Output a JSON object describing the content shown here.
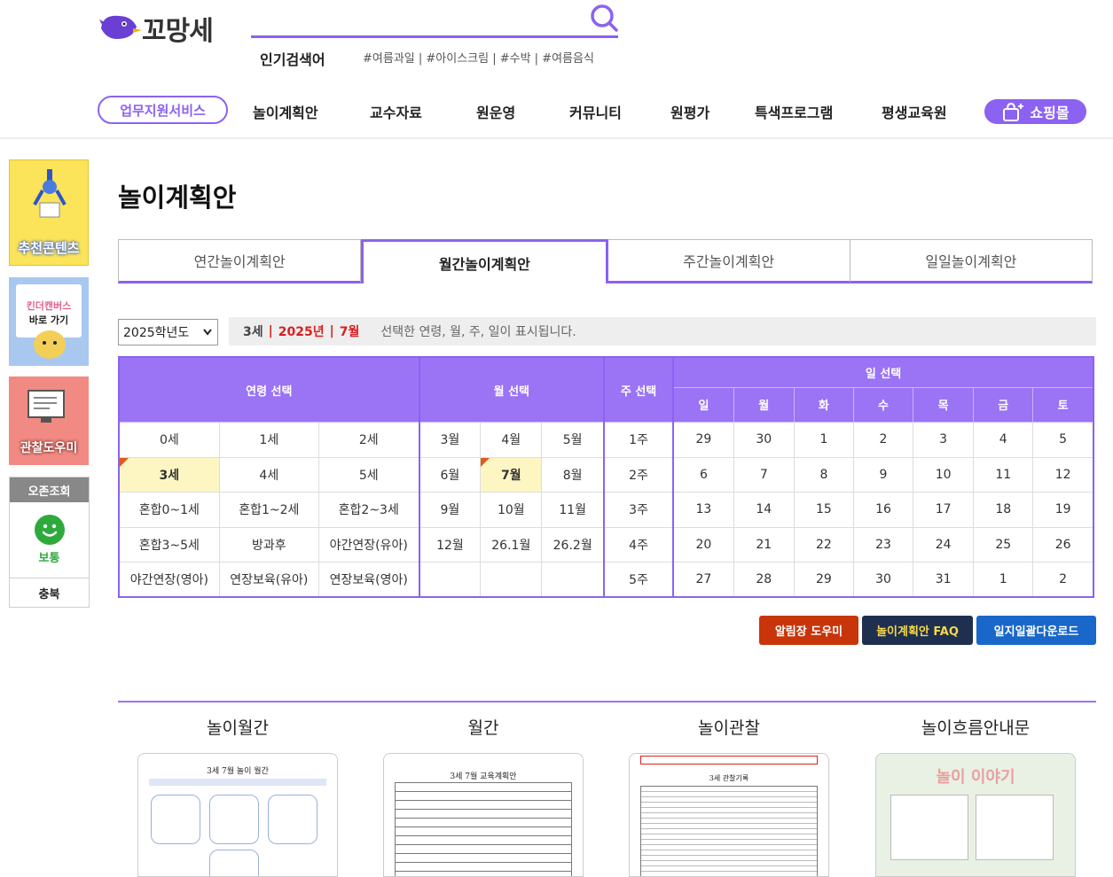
{
  "header": {
    "logo_text": "꼬망세",
    "popular_label": "인기검색어",
    "popular_tags": "#여름과일 | #아이스크림 | #수박 | #여름음식"
  },
  "nav": {
    "service": "업무지원서비스",
    "items": [
      "놀이계획안",
      "교수자료",
      "원운영",
      "커뮤니티",
      "원평가",
      "특색프로그램",
      "평생교육원"
    ],
    "shop": "쇼핑몰"
  },
  "side": {
    "reco": "추천콘텐츠",
    "kinder_top": "킨더캔버스",
    "kinder_bottom": "바로 가기",
    "observe": "관찰도우미",
    "weather_head": "오존조회",
    "weather_status": "보통",
    "weather_region": "충북"
  },
  "page": {
    "title": "놀이계획안",
    "tabs": [
      "연간놀이계획안",
      "월간놀이계획안",
      "주간놀이계획안",
      "일일놀이계획안"
    ],
    "active_tab": 1,
    "year_select": "2025학년도",
    "info_age": "3세",
    "info_year": "2025년",
    "info_month": "7월",
    "info_desc": "선택한 연령, 월, 주, 일이 표시됩니다."
  },
  "table": {
    "headers": {
      "age": "연령 선택",
      "month": "월 선택",
      "week": "주 선택",
      "day": "일 선택"
    },
    "weekdays": [
      "일",
      "월",
      "화",
      "수",
      "목",
      "금",
      "토"
    ],
    "rows": [
      {
        "ages": [
          "0세",
          "1세",
          "2세"
        ],
        "months": [
          "3월",
          "4월",
          "5월"
        ],
        "week": "1주",
        "days": [
          "29",
          "30",
          "1",
          "2",
          "3",
          "4",
          "5"
        ]
      },
      {
        "ages": [
          "3세",
          "4세",
          "5세"
        ],
        "months": [
          "6월",
          "7월",
          "8월"
        ],
        "week": "2주",
        "days": [
          "6",
          "7",
          "8",
          "9",
          "10",
          "11",
          "12"
        ]
      },
      {
        "ages": [
          "혼합0~1세",
          "혼합1~2세",
          "혼합2~3세"
        ],
        "months": [
          "9월",
          "10월",
          "11월"
        ],
        "week": "3주",
        "days": [
          "13",
          "14",
          "15",
          "16",
          "17",
          "18",
          "19"
        ]
      },
      {
        "ages": [
          "혼합3~5세",
          "방과후",
          "야간연장(유아)"
        ],
        "months": [
          "12월",
          "26.1월",
          "26.2월"
        ],
        "week": "4주",
        "days": [
          "20",
          "21",
          "22",
          "23",
          "24",
          "25",
          "26"
        ]
      },
      {
        "ages": [
          "야간연장(영아)",
          "연장보육(유아)",
          "연장보육(영아)"
        ],
        "months": [
          "",
          "",
          ""
        ],
        "week": "5주",
        "days": [
          "27",
          "28",
          "29",
          "30",
          "31",
          "1",
          "2"
        ]
      }
    ]
  },
  "buttons": {
    "notice": "알림장 도우미",
    "faq": "놀이계획안 FAQ",
    "download": "일지일괄다운로드"
  },
  "docs": [
    {
      "title": "놀이월간",
      "preview_heading": "3세 7월 놀이 월간"
    },
    {
      "title": "월간",
      "preview_heading": "3세 7월 교육계획안"
    },
    {
      "title": "놀이관찰",
      "preview_heading": "3세 관찰기록"
    },
    {
      "title": "놀이흐름안내문",
      "preview_heading": "놀이 이야기"
    }
  ],
  "colors": {
    "accent": "#8b62f2",
    "header_purple": "#9b73f5",
    "sunday": "#d83a3a",
    "saturday": "#2b56c9"
  }
}
